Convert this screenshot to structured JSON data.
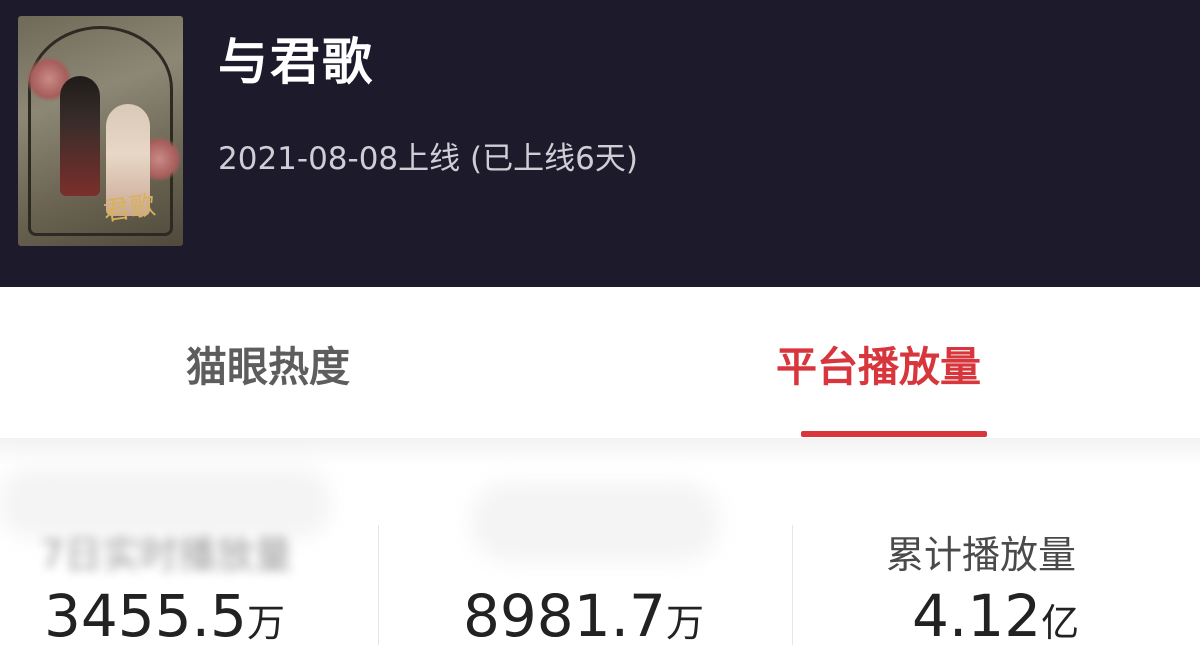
{
  "header": {
    "title": "与君歌",
    "release_info": "2021-08-08上线 (已上线6天)",
    "poster_art_text": "君歌"
  },
  "tabs": [
    {
      "label": "猫眼热度",
      "active": false
    },
    {
      "label": "平台播放量",
      "active": true
    }
  ],
  "stats": [
    {
      "label": "7日实时播放量",
      "value": "3455.5",
      "unit": "万"
    },
    {
      "label": "",
      "value": "8981.7",
      "unit": "万"
    },
    {
      "label": "累计播放量",
      "value": "4.12",
      "unit": "亿"
    }
  ],
  "colors": {
    "header_bg": "#1d1a2b",
    "accent": "#d8363d",
    "tab_inactive": "#5d5d5d"
  }
}
